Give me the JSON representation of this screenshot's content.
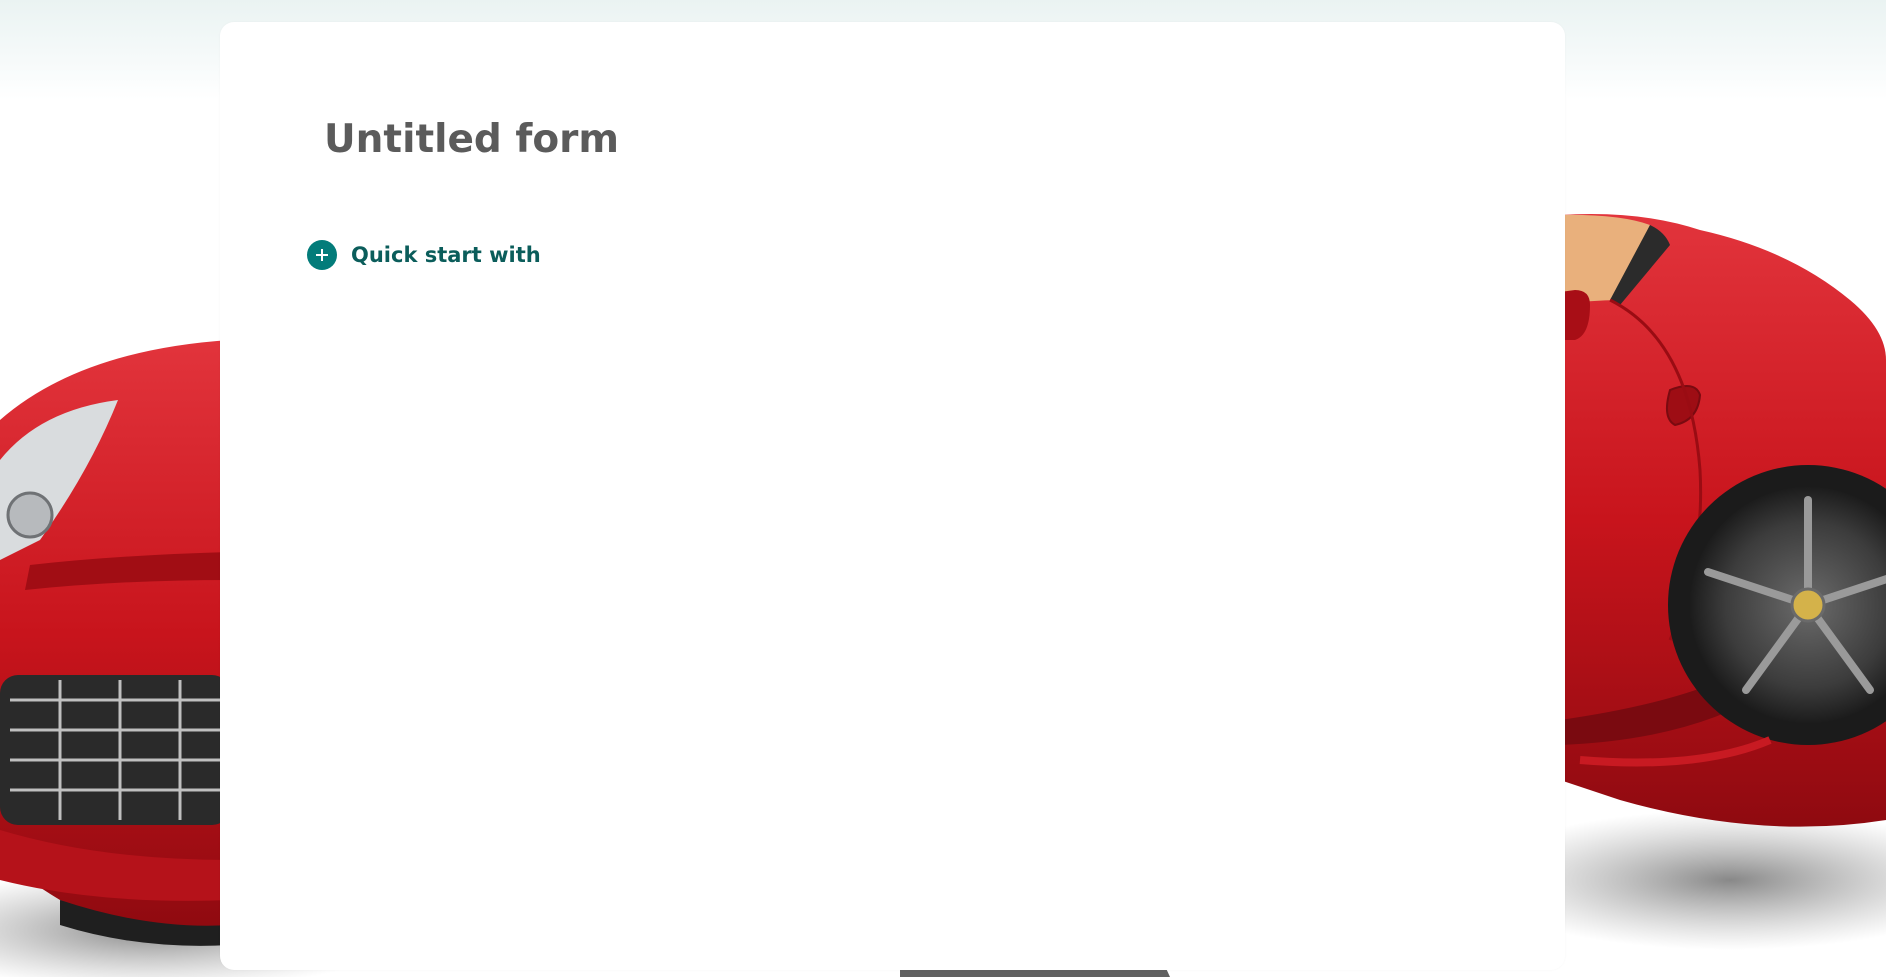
{
  "form": {
    "title": "Untitled form"
  },
  "quick_start": {
    "label": "Quick start with",
    "icon": "plus-circle-icon"
  },
  "theme": {
    "accent": "#037c7a",
    "accent_text": "#0b5d5b",
    "title_color": "#5b5b5b",
    "background_image": "red convertible sports car"
  }
}
